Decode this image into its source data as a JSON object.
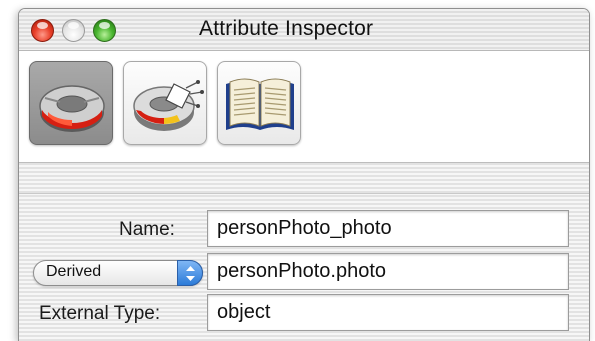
{
  "window": {
    "title": "Attribute Inspector"
  },
  "toolbar": {
    "tools": [
      {
        "icon": "attribute-inspector-icon",
        "active": true
      },
      {
        "icon": "relationship-inspector-icon",
        "active": false
      },
      {
        "icon": "book-icon",
        "active": false
      }
    ]
  },
  "form": {
    "name_label": "Name:",
    "name_value": "personPhoto_photo",
    "column_popup_value": "Derived",
    "column_value": "personPhoto.photo",
    "external_type_label": "External Type:",
    "external_type_value": "object"
  },
  "colors": {
    "accent": "#2c7bd8",
    "close": "#e8402a",
    "minimize": "#e4e4e4",
    "zoom": "#49b52f"
  }
}
